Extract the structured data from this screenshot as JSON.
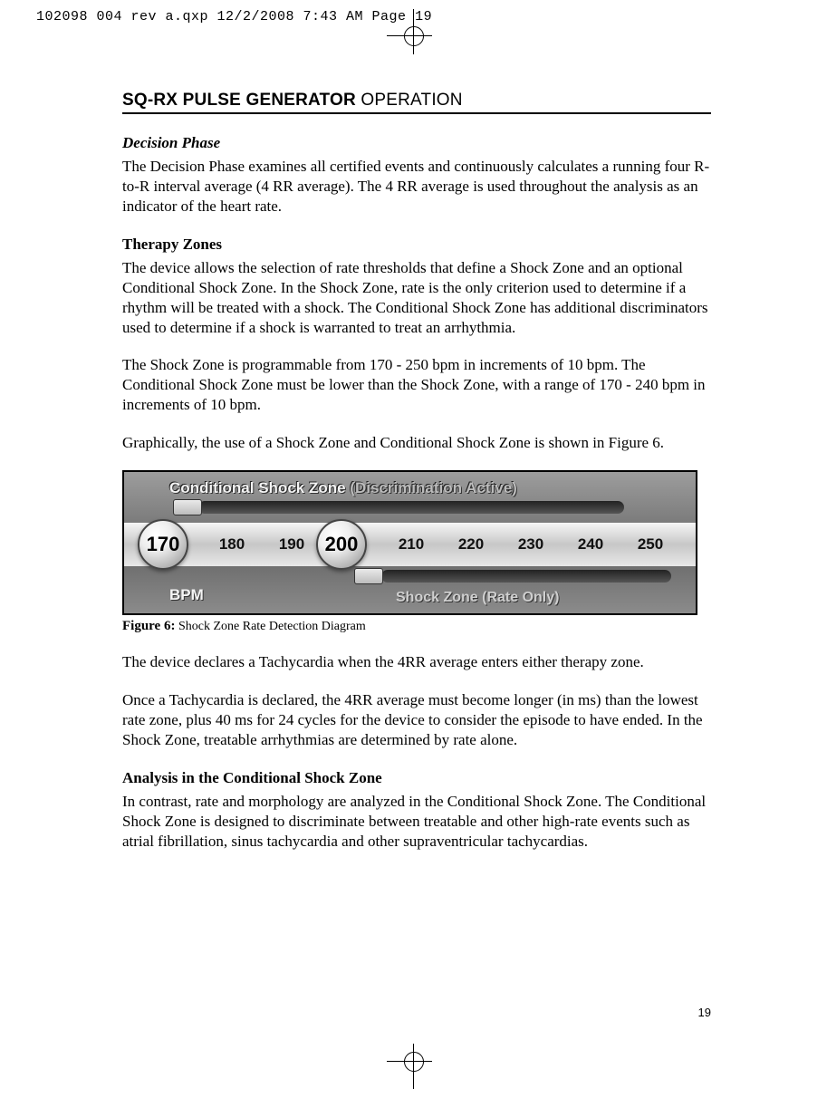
{
  "slug": "102098 004 rev a.qxp  12/2/2008  7:43 AM  Page 19",
  "header": {
    "bold": "SQ-RX PULSE GENERATOR",
    "light": " OPERATION"
  },
  "decision_phase": {
    "title": "Decision Phase",
    "p1": "The Decision Phase examines all certified events and continuously calculates a running four R-to-R interval average (4 RR average). The 4 RR average is used throughout the analysis as an indicator of the heart rate."
  },
  "therapy_zones": {
    "title": "Therapy Zones",
    "p1": "The device allows the selection of rate thresholds that define a Shock Zone and an optional Conditional Shock Zone. In the Shock Zone, rate is the only criterion used to determine if a rhythm will be treated with a shock. The Conditional Shock Zone has additional discriminators used to determine if a shock is warranted to treat an arrhythmia.",
    "p2": "The Shock Zone is programmable from 170 - 250 bpm in increments of 10 bpm. The Conditional Shock Zone must be lower than the Shock Zone, with a range of 170 - 240 bpm in increments of 10 bpm.",
    "p3": "Graphically, the use of a Shock Zone and Conditional Shock Zone is shown in Figure 6."
  },
  "figure": {
    "conditional_label": "Conditional Shock Zone",
    "discrimination": " (Discrimination Active)",
    "ticks": [
      "170",
      "180",
      "190",
      "200",
      "210",
      "220",
      "230",
      "240",
      "250"
    ],
    "knob_left": "170",
    "knob_right": "200",
    "bpm": "BPM",
    "shock_zone": "Shock Zone (Rate Only)",
    "caption_bold": "Figure 6:",
    "caption_rest": " Shock Zone Rate Detection Diagram"
  },
  "after_fig": {
    "p1": "The device declares a Tachycardia when the 4RR average enters either therapy zone.",
    "p2": "Once a Tachycardia is declared, the 4RR average must become longer (in ms) than the lowest rate zone, plus 40 ms for 24 cycles for the device to consider the episode to have ended.  In the Shock Zone, treatable arrhythmias are determined by rate alone."
  },
  "analysis": {
    "title": "Analysis in the Conditional Shock Zone",
    "p1": "In contrast, rate and morphology are analyzed in the Conditional Shock Zone. The Conditional Shock Zone is designed to discriminate between treatable and other high-rate events such as atrial fibrillation, sinus tachycardia and other supraventricular tachycardias."
  },
  "page_number": "19"
}
